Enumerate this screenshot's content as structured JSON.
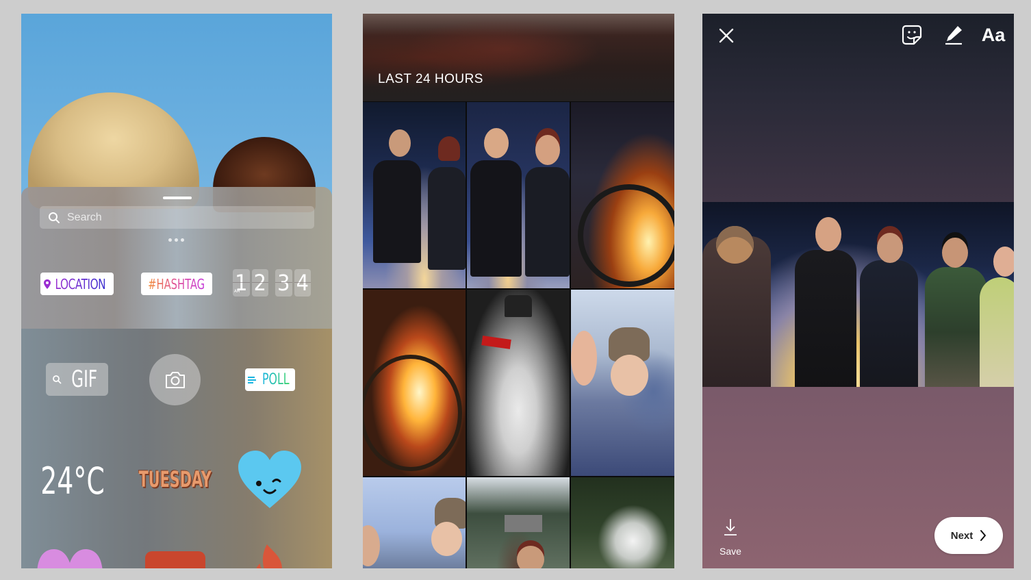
{
  "panels": {
    "sticker_tray": {
      "search": {
        "placeholder": "Search",
        "value": ""
      },
      "stickers": [
        {
          "id": "location",
          "label": "LOCATION",
          "icon": "location-pin-icon",
          "color_from": "#9a2ed1",
          "color_to": "#3a30cf"
        },
        {
          "id": "hashtag",
          "label": "#HASHTAG",
          "color_from": "#f28a32",
          "color_to": "#c338d8"
        },
        {
          "id": "time",
          "digits": [
            "1",
            "2",
            "3",
            "4"
          ],
          "meridiem": "AM"
        },
        {
          "id": "gif",
          "label": "GIF",
          "icon": "search-icon"
        },
        {
          "id": "camera",
          "icon": "camera-icon"
        },
        {
          "id": "poll",
          "label": "POLL",
          "icon": "poll-lines-icon",
          "color_from": "#18b4e0",
          "color_to": "#3ad36a"
        },
        {
          "id": "temperature",
          "label": "24°C"
        },
        {
          "id": "weekday",
          "label": "TUESDAY"
        },
        {
          "id": "winking-heart",
          "icon": "winking-heart-icon",
          "color": "#5bc8f0"
        },
        {
          "id": "pink-heart",
          "icon": "heart-icon",
          "color": "#d88ce0"
        },
        {
          "id": "red-badge",
          "color": "#c9462d"
        },
        {
          "id": "fire",
          "icon": "fire-icon",
          "color": "#d9563a"
        }
      ]
    },
    "gallery": {
      "section_title": "LAST 24 HOURS",
      "photos": [
        {
          "subject": "two friends roasting marshmallows at night"
        },
        {
          "subject": "two friends posing in snow at night"
        },
        {
          "subject": "campfire with marshmallow sticks"
        },
        {
          "subject": "fire pit close-up"
        },
        {
          "subject": "snowman at night"
        },
        {
          "subject": "selfie in snow"
        },
        {
          "subject": "selfie with fur hat"
        },
        {
          "subject": "snowy forest with cabin"
        },
        {
          "subject": "snow on pine branches"
        }
      ]
    },
    "editor": {
      "toolbar": {
        "close_icon": "close-icon",
        "sticker_icon": "sticker-icon",
        "draw_icon": "pen-icon",
        "text_label": "Aa"
      },
      "photo_subject": "group of friends roasting marshmallows in the snow",
      "save_label": "Save",
      "next_label": "Next"
    }
  },
  "colors": {
    "background": "#cdcdcd",
    "sky": "#6bb0e0",
    "editor_top": "#1c202a",
    "editor_bottom": "#8d6470"
  }
}
